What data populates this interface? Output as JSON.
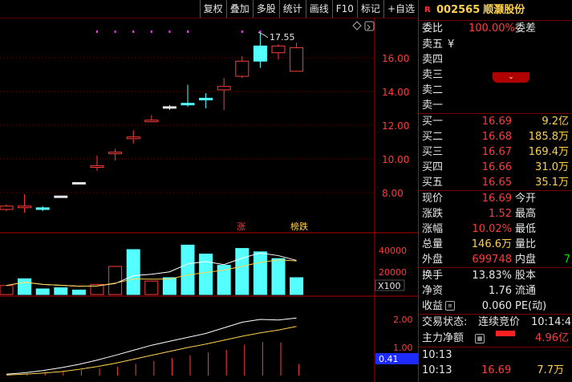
{
  "toolbar": {
    "items": [
      "复权",
      "叠加",
      "多股",
      "统计",
      "画线",
      "F10",
      "标记",
      "+自选"
    ]
  },
  "main_chart": {
    "high_label": "17.55",
    "y_ticks": [
      "16.00",
      "14.00",
      "12.00",
      "10.00",
      "8.00"
    ],
    "tag_up": "涨",
    "tag_down": "榜跌"
  },
  "volume_chart": {
    "y_ticks": [
      "40000",
      "20000"
    ],
    "unit": "X100"
  },
  "indicator_chart": {
    "y_ticks": [
      "2.00",
      "1.00"
    ],
    "current_value": "0.41"
  },
  "chart_data": [
    {
      "type": "candlestick",
      "x": [
        1,
        2,
        3,
        4,
        5,
        6,
        7,
        8,
        9,
        10,
        11,
        12,
        13,
        14,
        15,
        16,
        17
      ],
      "open": [
        7.0,
        7.2,
        7.0,
        7.8,
        8.6,
        9.5,
        10.4,
        11.3,
        12.3,
        13.1,
        13.3,
        13.6,
        14.1,
        14.9,
        15.8,
        16.7,
        15.2
      ],
      "close": [
        7.2,
        7.2,
        7.1,
        7.8,
        8.6,
        9.6,
        10.4,
        11.2,
        12.3,
        13.1,
        13.3,
        13.5,
        14.3,
        15.8,
        16.7,
        16.3,
        16.6
      ],
      "high": [
        7.3,
        7.9,
        7.2,
        7.8,
        8.6,
        10.2,
        10.6,
        11.7,
        12.6,
        13.2,
        14.4,
        13.9,
        14.8,
        16.1,
        17.55,
        16.8,
        16.9
      ],
      "low": [
        6.9,
        6.8,
        6.9,
        7.8,
        8.6,
        9.3,
        9.9,
        10.9,
        12.2,
        12.9,
        13.1,
        13.0,
        12.9,
        14.8,
        15.4,
        15.9,
        15.2
      ],
      "direction": [
        "up",
        "up",
        "down",
        "flat",
        "flat",
        "up",
        "up",
        "up",
        "up",
        "flat",
        "down",
        "down",
        "up",
        "up",
        "down",
        "up",
        "up"
      ],
      "ylim": [
        7.0,
        18.0
      ]
    },
    {
      "type": "bar",
      "series": [
        {
          "values": [
            8000,
            14000,
            5000,
            6000,
            4000,
            9000,
            25000,
            40000,
            12000,
            15000,
            44000,
            36000,
            26000,
            41000,
            38000,
            32000,
            15000
          ]
        }
      ],
      "ylim": [
        0,
        48000
      ]
    },
    {
      "type": "bar",
      "series": [
        {
          "values": [
            0.03,
            0.07,
            0.1,
            0.15,
            0.2,
            0.25,
            0.32,
            0.42,
            0.52,
            0.62,
            0.72,
            0.82,
            0.92,
            1.1,
            1.2,
            1.18,
            0.41
          ]
        }
      ],
      "ylim": [
        0,
        2.5
      ]
    }
  ],
  "panel": {
    "badge": "R",
    "code": "002565",
    "name": "顺灏股份",
    "weibi_label": "委比",
    "weibi_value": "100.00%",
    "weicha_label": "委差",
    "sell": [
      {
        "label": "卖五",
        "extra": "¥"
      },
      {
        "label": "卖四"
      },
      {
        "label": "卖三"
      },
      {
        "label": "卖二"
      },
      {
        "label": "卖一"
      }
    ],
    "buy": [
      {
        "label": "买一",
        "price": "16.69",
        "vol": "9.2亿"
      },
      {
        "label": "买二",
        "price": "16.68",
        "vol": "185.8万"
      },
      {
        "label": "买三",
        "price": "16.67",
        "vol": "169.4万"
      },
      {
        "label": "买四",
        "price": "16.66",
        "vol": "31.0万"
      },
      {
        "label": "买五",
        "price": "16.65",
        "vol": "35.1万"
      }
    ],
    "stats": [
      {
        "l1": "现价",
        "v1": "16.69",
        "l2": "今开"
      },
      {
        "l1": "涨跌",
        "v1": "1.52",
        "l2": "最高"
      },
      {
        "l1": "涨幅",
        "v1": "10.02%",
        "l2": "最低"
      },
      {
        "l1": "总量",
        "v1": "146.6万",
        "l2": "量比"
      },
      {
        "l1": "外盘",
        "v1": "699748",
        "l2": "内盘",
        "v2": "7"
      }
    ],
    "finance": [
      {
        "l1": "换手",
        "v1": "13.83%",
        "l2": "股本"
      },
      {
        "l1": "净资",
        "v1": "1.76",
        "l2": "流通"
      },
      {
        "l1": "收益",
        "v1": "0.060",
        "l2": "PE(动)"
      }
    ],
    "trade_state_label": "交易状态:",
    "trade_state_value": "连续竞价",
    "trade_time": "10:14:4",
    "main_flow_label": "主力净额",
    "main_flow_value": "4.96亿",
    "ticks": [
      {
        "time": "10:13"
      },
      {
        "time": "10:13",
        "price": "16.69",
        "vol": "7.7万"
      }
    ]
  }
}
